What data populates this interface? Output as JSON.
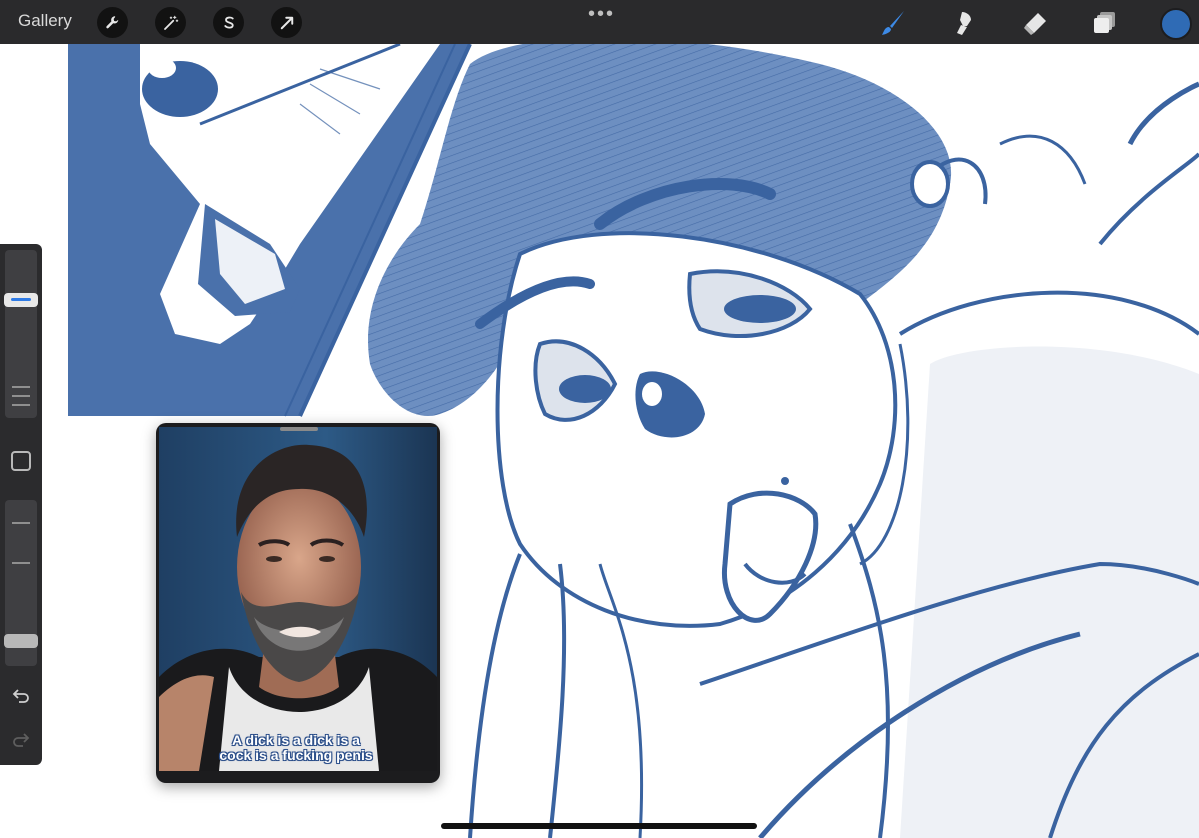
{
  "app": {
    "gallery_label": "Gallery",
    "actions_icon": "wrench-icon",
    "adjustments_icon": "magic-wand-icon",
    "selection_icon": "selection-s-icon",
    "transform_icon": "arrow-cursor-icon",
    "more_icon": "more-dots-icon",
    "more_label": "•••"
  },
  "tools": {
    "brush_icon": "brush-icon",
    "smudge_icon": "smudge-icon",
    "eraser_icon": "eraser-icon",
    "layers_icon": "layers-icon",
    "active_color": "#2f6bb5"
  },
  "sidebar": {
    "brush_size": 0.72,
    "opacity": 0.12,
    "undo_icon": "undo-icon",
    "redo_icon": "redo-icon",
    "modify_icon": "square-icon"
  },
  "pip": {
    "caption_line1": "A dick is a dick is a",
    "caption_line2": "cock is a fucking penis"
  },
  "colors": {
    "ink": "#3a63a0",
    "ink_fill": "#4a71ab",
    "toolbar_bg": "#2a2a2c"
  }
}
